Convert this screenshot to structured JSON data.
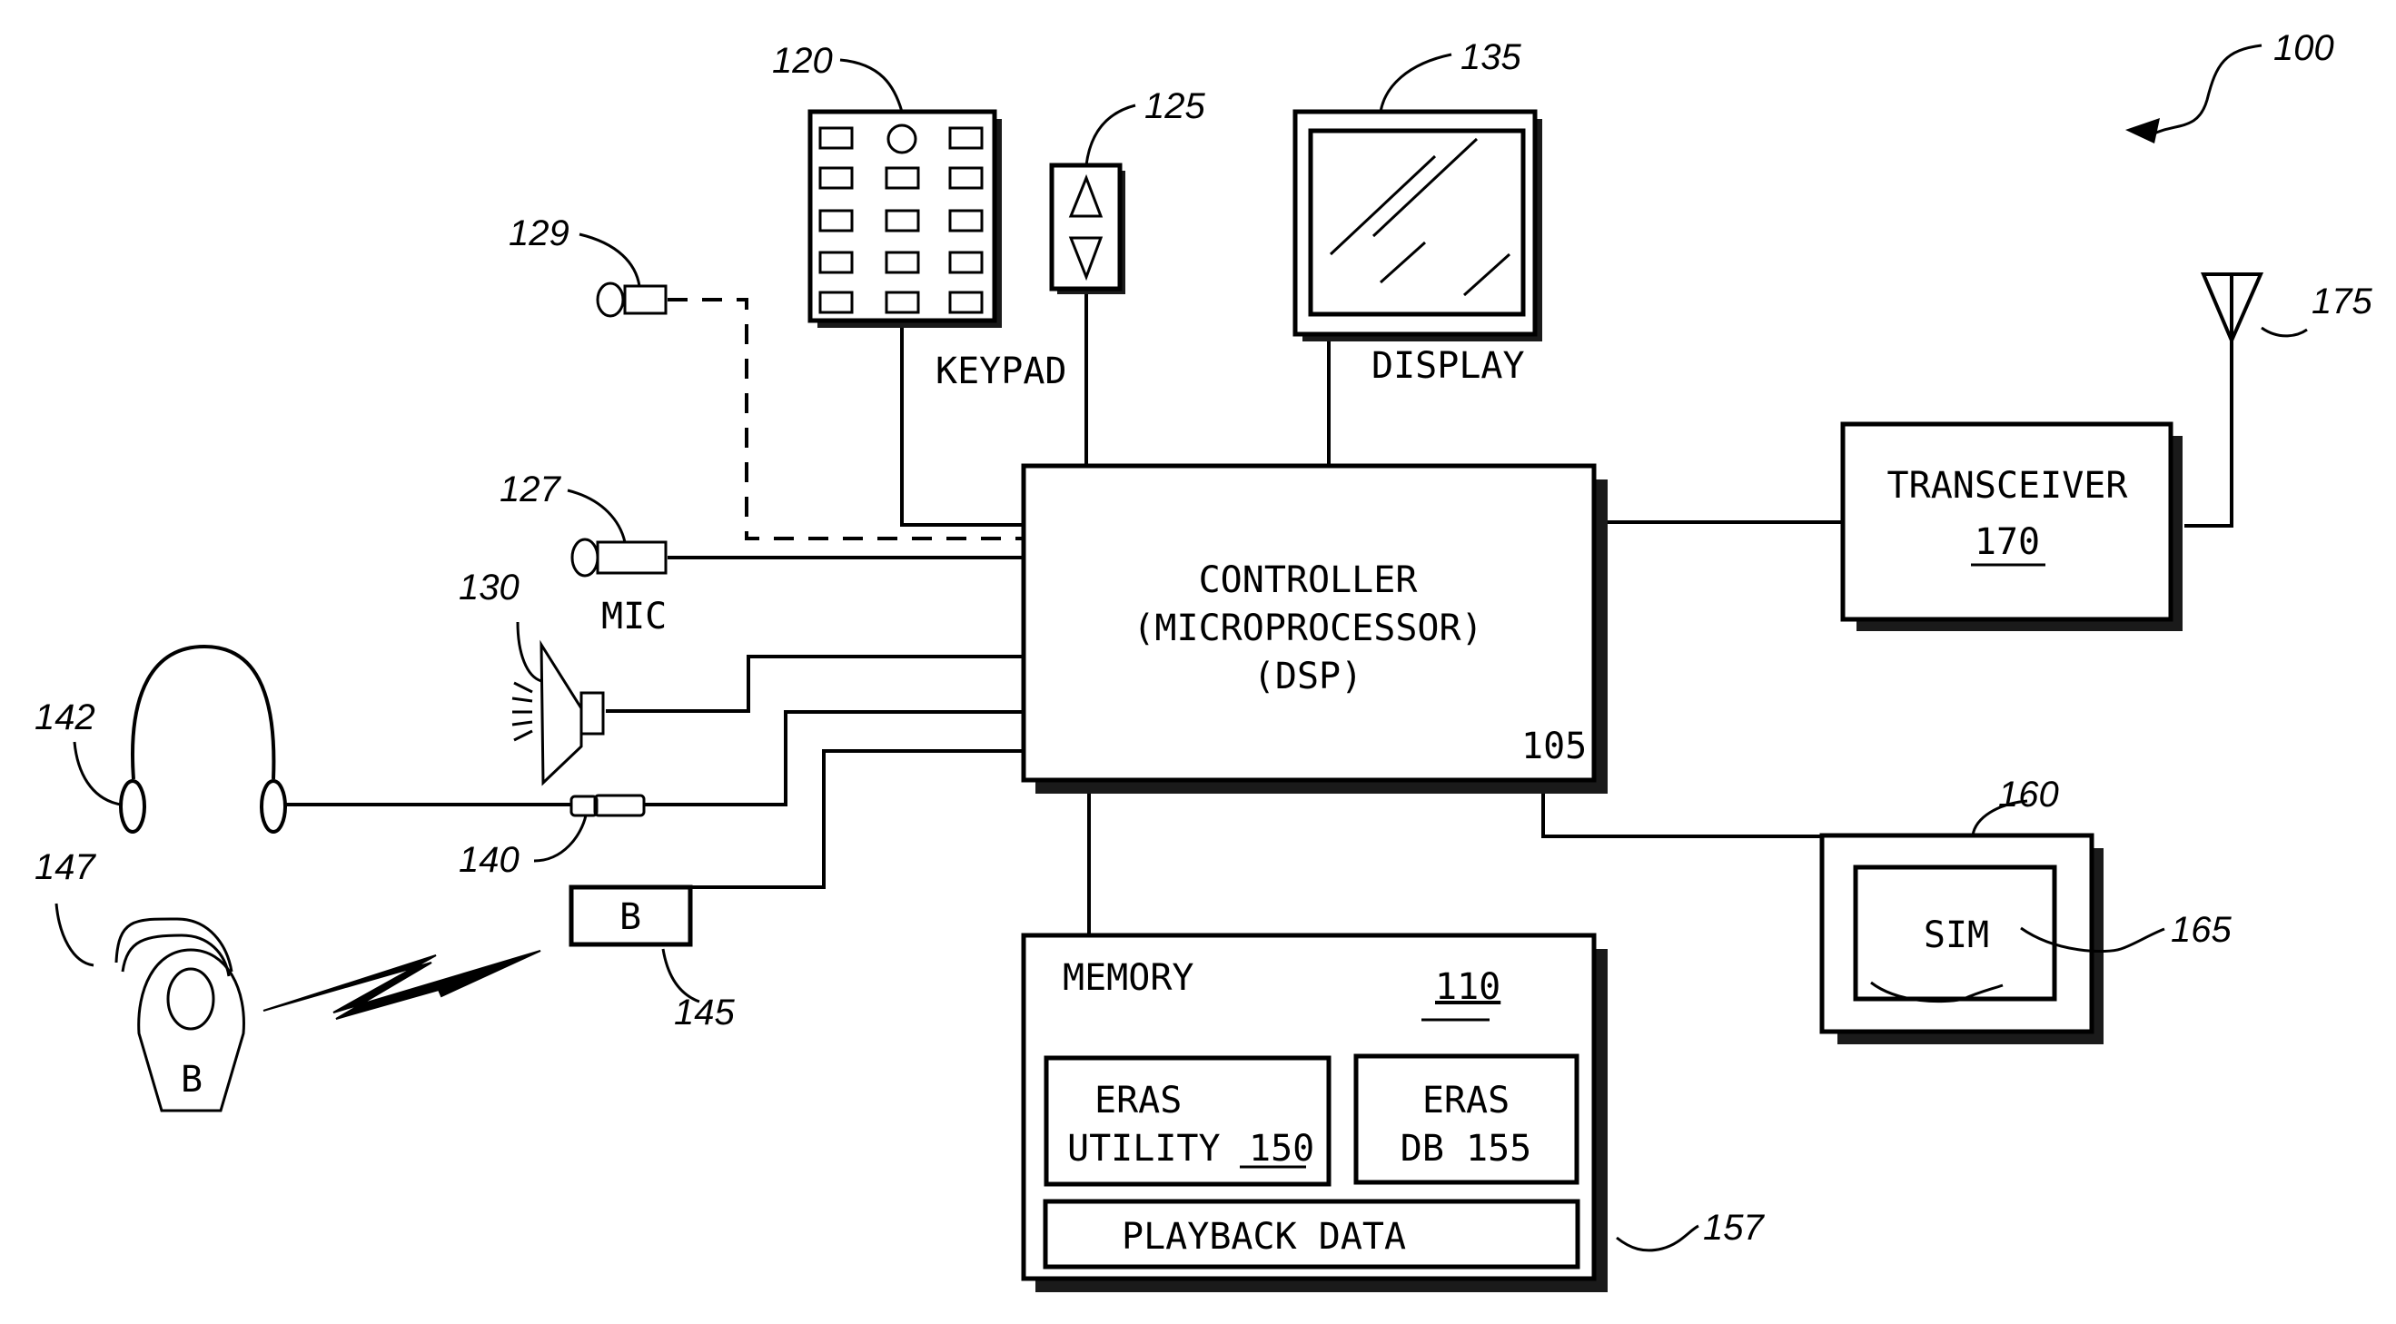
{
  "figure": {
    "ref": "100",
    "colors": {
      "ink": "#000000",
      "paper": "#ffffff",
      "shadow": "#1a1a1a"
    }
  },
  "controller": {
    "lines": [
      "CONTROLLER",
      "(MICROPROCESSOR)",
      "(DSP)"
    ],
    "ref": "105"
  },
  "memory": {
    "label": "MEMORY",
    "ref": "110",
    "eras_utility": {
      "lines": [
        "ERAS",
        "UTILITY"
      ],
      "ref": "150"
    },
    "eras_db": {
      "lines": [
        "ERAS",
        "DB 155"
      ]
    },
    "playback": {
      "label": "PLAYBACK DATA",
      "ref": "157"
    }
  },
  "keypad": {
    "label": "KEYPAD",
    "ref": "120"
  },
  "scroll": {
    "ref": "125",
    "up_icon": "up-triangle-icon",
    "down_icon": "down-triangle-icon"
  },
  "display": {
    "label": "DISPLAY",
    "ref": "135"
  },
  "mic": {
    "label": "MIC",
    "ref": "127"
  },
  "aux_mic": {
    "ref": "129"
  },
  "speaker": {
    "ref": "130"
  },
  "jack": {
    "ref": "140"
  },
  "headphones": {
    "ref": "142"
  },
  "bt_module": {
    "label": "B",
    "ref": "145"
  },
  "bt_headset": {
    "label": "B",
    "ref": "147"
  },
  "transceiver": {
    "label": "TRANSCEIVER",
    "ref": "170"
  },
  "antenna": {
    "ref": "175"
  },
  "sim_holder": {
    "ref": "160"
  },
  "sim": {
    "label": "SIM",
    "ref": "165"
  }
}
